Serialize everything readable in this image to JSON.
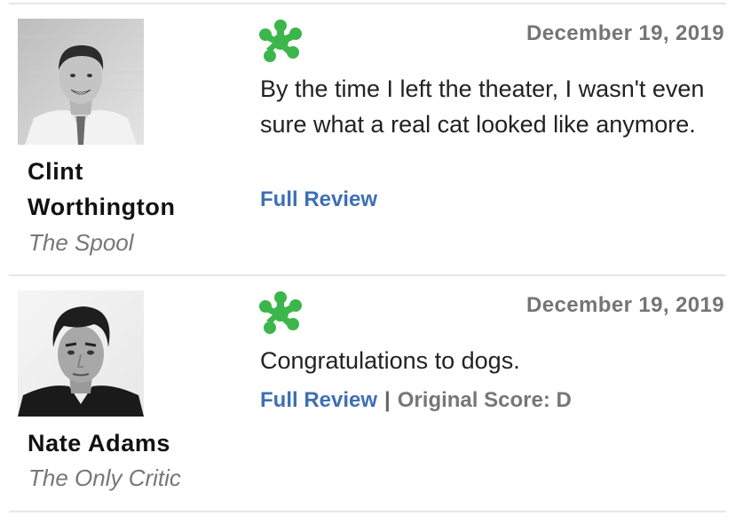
{
  "colors": {
    "fresh_splat": "#3cb64b",
    "link": "#3f6fb5",
    "meta_gray": "#757575",
    "publication_gray": "#777777"
  },
  "reviews": [
    {
      "critic_name": "Clint Worthington",
      "publication": "The Spool",
      "score_icon": "rotten-splat-icon",
      "date": "December 19, 2019",
      "quote": "By the time I left the theater, I wasn't even sure what a real cat looked like anymore.",
      "link_label": "Full Review",
      "original_score": ""
    },
    {
      "critic_name": "Nate Adams",
      "publication": "The Only Critic",
      "score_icon": "rotten-splat-icon",
      "date": "December 19, 2019",
      "quote": "Congratulations to dogs.",
      "link_label": "Full Review",
      "separator": "|",
      "original_score": "Original Score: D"
    }
  ]
}
